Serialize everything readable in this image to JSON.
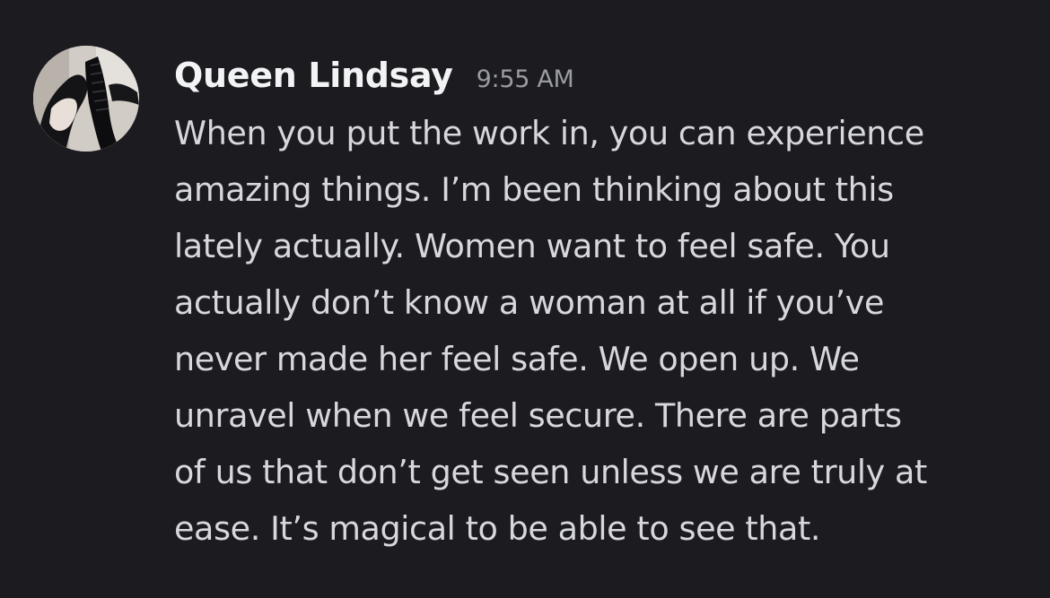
{
  "message": {
    "author": "Queen Lindsay",
    "timestamp": "9:55 AM",
    "lines": [
      "When you put the work in, you can experience",
      "amazing things. I’m been thinking about this",
      "lately actually. Women want to feel safe. You",
      "actually don’t know a woman at all if you’ve",
      "never made her feel safe. We open up. We",
      "unravel when we feel secure. There are parts",
      "of us that don’t get seen unless we are truly at",
      "ease. It’s magical to be able to see that."
    ]
  },
  "colors": {
    "background": "#1b1b20",
    "author": "#f2f3f5",
    "timestamp": "#9a9ca3",
    "body_text": "#d7d8dc"
  }
}
